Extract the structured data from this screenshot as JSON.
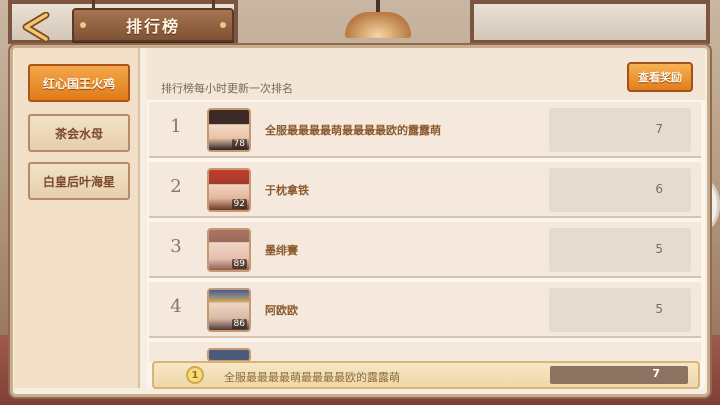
{
  "header": {
    "title": "排行榜"
  },
  "sidebar": {
    "items": [
      {
        "label": "红心国王火鸡",
        "active": true
      },
      {
        "label": "茶会水母",
        "active": false
      },
      {
        "label": "白皇后叶海星",
        "active": false
      }
    ]
  },
  "leaderboard": {
    "info": "排行榜每小时更新一次排名",
    "reward_button": "查看奖励",
    "rows": [
      {
        "rank": "1",
        "name": "全服最最最最萌最最最最欧的露露萌",
        "level": "78",
        "score": "7"
      },
      {
        "rank": "2",
        "name": "于枕拿铁",
        "level": "92",
        "score": "6"
      },
      {
        "rank": "3",
        "name": "墨绯賽",
        "level": "89",
        "score": "5"
      },
      {
        "rank": "4",
        "name": "阿欧欧",
        "level": "86",
        "score": "5"
      }
    ]
  },
  "self_entry": {
    "rank": "1",
    "name": "全服最最最最萌最最最最欧的露露萌",
    "score": "7"
  },
  "colors": {
    "accent_orange": "#e47d1d",
    "panel": "#f7eee3",
    "wood": "#7e5236"
  }
}
